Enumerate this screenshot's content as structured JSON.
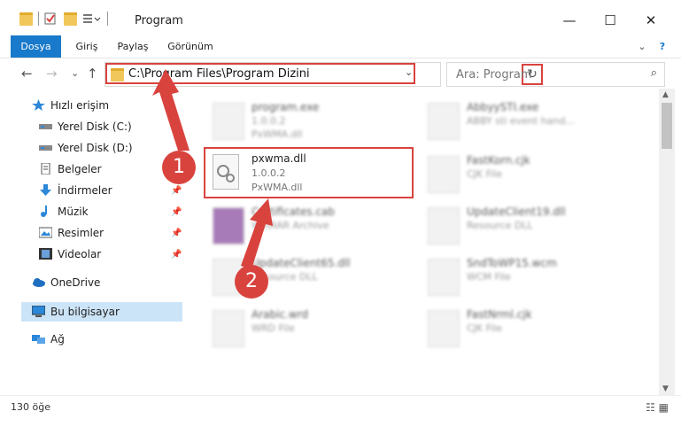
{
  "window": {
    "title": "Program",
    "minimize": "—",
    "maximize": "☐",
    "close": "✕"
  },
  "ribbon": {
    "tabs": [
      "Dosya",
      "Giriş",
      "Paylaş",
      "Görünüm"
    ],
    "collapse": "⌄",
    "help": "?"
  },
  "address": {
    "back": "←",
    "forward": "→",
    "recent": "⌄",
    "up": "↑",
    "path": "C:\\Program Files\\Program Dizini",
    "chevron": "⌄",
    "refresh": "↻",
    "search_placeholder": "Ara: Program",
    "search_icon": "⌕"
  },
  "sidebar": {
    "items": [
      {
        "label": "Hızlı erişim",
        "icon": "star-icon"
      },
      {
        "label": "Yerel Disk (C:)",
        "icon": "drive-icon"
      },
      {
        "label": "Yerel Disk (D:)",
        "icon": "drive-icon"
      },
      {
        "label": "Belgeler",
        "icon": "documents-icon"
      },
      {
        "label": "İndirmeler",
        "icon": "download-icon"
      },
      {
        "label": "Müzik",
        "icon": "music-icon"
      },
      {
        "label": "Resimler",
        "icon": "pictures-icon"
      },
      {
        "label": "Videolar",
        "icon": "videos-icon"
      },
      {
        "label": "OneDrive",
        "icon": "cloud-icon"
      },
      {
        "label": "Bu bilgisayar",
        "icon": "computer-icon"
      },
      {
        "label": "Ağ",
        "icon": "network-icon"
      }
    ],
    "pin": "📌"
  },
  "files": [
    {
      "name": "program.exe",
      "line2": "1.0.0.2",
      "line3": "PxWMA.dll"
    },
    {
      "name": "AbbyySTI.exe",
      "line2": "ABBY sti event hand...",
      "line3": ""
    },
    {
      "name": "FastKorn.cjk",
      "line2": "CJK File",
      "line3": ""
    },
    {
      "name": "Certificates.cab",
      "line2": "WinRAR Archive",
      "line3": ""
    },
    {
      "name": "UpdateClient19.dll",
      "line2": "Resource DLL",
      "line3": ""
    },
    {
      "name": "UpdateClient65.dll",
      "line2": "Resource DLL",
      "line3": ""
    },
    {
      "name": "SndToWP15.wcm",
      "line2": "WCM File",
      "line3": ""
    },
    {
      "name": "Arabic.wrd",
      "line2": "WRD File",
      "line3": ""
    },
    {
      "name": "FastNrml.cjk",
      "line2": "CJK File",
      "line3": ""
    }
  ],
  "highlighted_file": {
    "name": "pxwma.dll",
    "version": "1.0.0.2",
    "description": "PxWMA.dll"
  },
  "markers": {
    "one": "1",
    "two": "2"
  },
  "status": {
    "count": "130 öğe",
    "views": "☷ ▦"
  },
  "colors": {
    "accent": "#1979ca",
    "highlight": "#d9433e",
    "selection": "#cce4f7"
  }
}
